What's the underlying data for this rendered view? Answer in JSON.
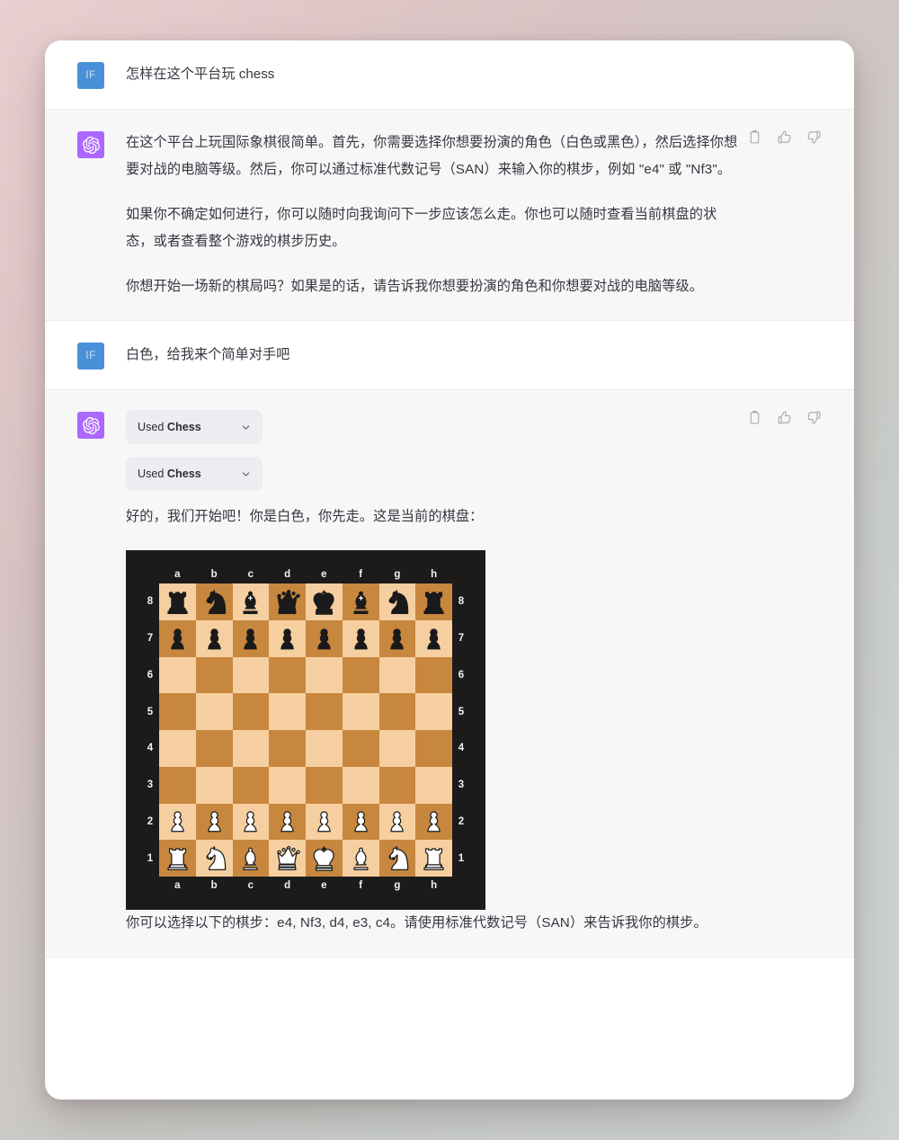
{
  "conversation": [
    {
      "role": "user",
      "avatar_initials": "IF",
      "text": "怎样在这个平台玩 chess"
    },
    {
      "role": "assistant",
      "paragraphs": [
        "在这个平台上玩国际象棋很简单。首先，你需要选择你想要扮演的角色（白色或黑色），然后选择你想要对战的电脑等级。然后，你可以通过标准代数记号（SAN）来输入你的棋步，例如 \"e4\" 或 \"Nf3\"。",
        "如果你不确定如何进行，你可以随时向我询问下一步应该怎么走。你也可以随时查看当前棋盘的状态，或者查看整个游戏的棋步历史。",
        "你想开始一场新的棋局吗？如果是的话，请告诉我你想要扮演的角色和你想要对战的电脑等级。"
      ]
    },
    {
      "role": "user",
      "avatar_initials": "IF",
      "text": "白色，给我来个简单对手吧"
    },
    {
      "role": "assistant",
      "tools": [
        {
          "prefix": "Used",
          "name": "Chess"
        },
        {
          "prefix": "Used",
          "name": "Chess"
        }
      ],
      "intro": "好的，我们开始吧！你是白色，你先走。这是当前的棋盘：",
      "outro": "你可以选择以下的棋步：e4, Nf3, d4, e3, c4。请使用标准代数记号（SAN）来告诉我你的棋步。"
    }
  ],
  "actions": {
    "copy_label": "copy-icon",
    "thumbs_up_label": "thumbs-up-icon",
    "thumbs_down_label": "thumbs-down-icon"
  },
  "chessboard": {
    "files": [
      "a",
      "b",
      "c",
      "d",
      "e",
      "f",
      "g",
      "h"
    ],
    "ranks": [
      "8",
      "7",
      "6",
      "5",
      "4",
      "3",
      "2",
      "1"
    ],
    "orientation": "white",
    "colors": {
      "light_square": "#f6cfa0",
      "dark_square": "#c7873e",
      "border": "#1c1b19",
      "coordinate_text": "#f2f2f2"
    },
    "first_square_light": true,
    "position_fen": "rnbqkbnr/pppppppp/8/8/8/8/PPPPPPPP/RNBQKBNR",
    "rows": [
      [
        "br",
        "bn",
        "bb",
        "bq",
        "bk",
        "bb",
        "bn",
        "br"
      ],
      [
        "bp",
        "bp",
        "bp",
        "bp",
        "bp",
        "bp",
        "bp",
        "bp"
      ],
      [
        "",
        "",
        "",
        "",
        "",
        "",
        "",
        ""
      ],
      [
        "",
        "",
        "",
        "",
        "",
        "",
        "",
        ""
      ],
      [
        "",
        "",
        "",
        "",
        "",
        "",
        "",
        ""
      ],
      [
        "",
        "",
        "",
        "",
        "",
        "",
        "",
        ""
      ],
      [
        "wp",
        "wp",
        "wp",
        "wp",
        "wp",
        "wp",
        "wp",
        "wp"
      ],
      [
        "wr",
        "wn",
        "wb",
        "wq",
        "wk",
        "wb",
        "wn",
        "wr"
      ]
    ],
    "suggested_moves": [
      "e4",
      "Nf3",
      "d4",
      "e3",
      "c4"
    ]
  },
  "theme": {
    "user_avatar_bg": "#4a90d9",
    "assistant_avatar_bg": "#ab68ff",
    "assistant_row_bg": "#f7f7f8",
    "user_row_bg": "#ffffff",
    "text_color": "#34373f",
    "chip_bg": "#ececf1"
  }
}
